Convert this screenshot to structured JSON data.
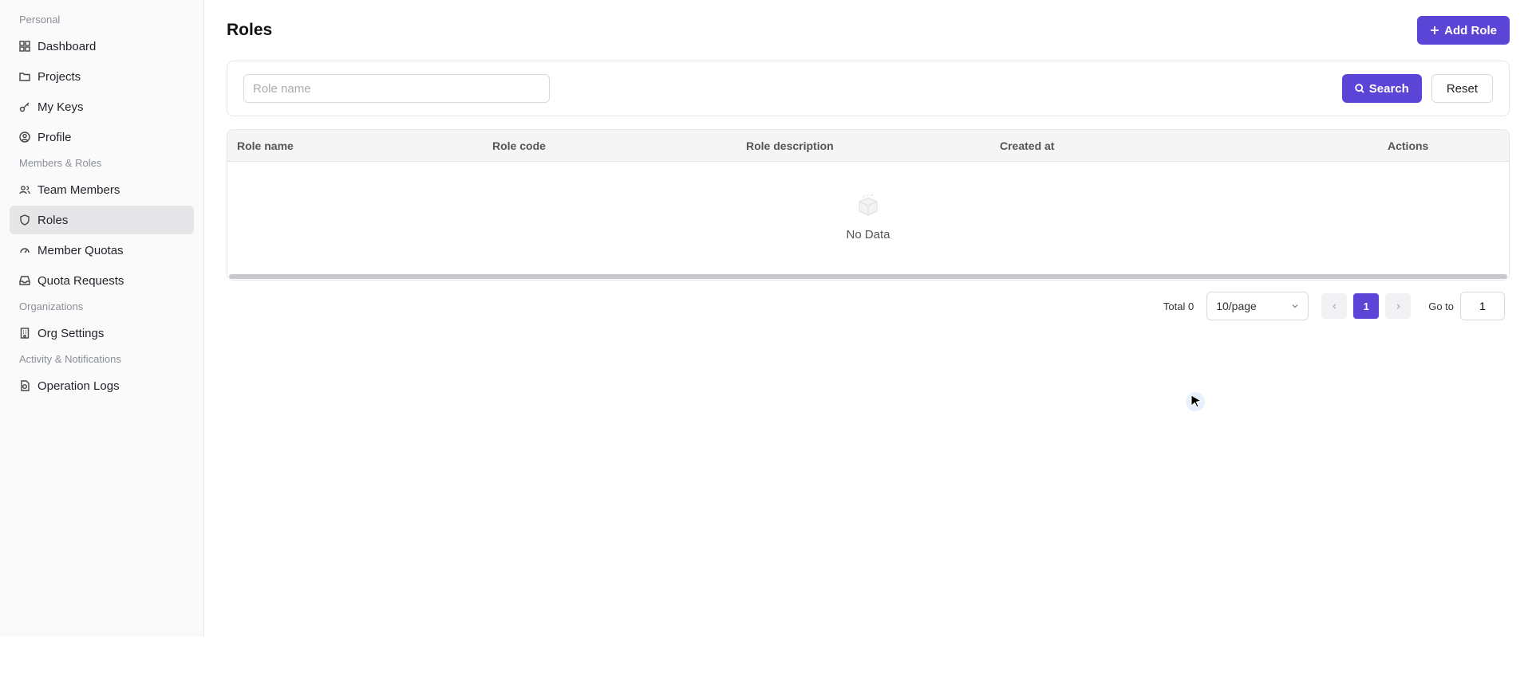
{
  "sidebar": {
    "sections": [
      {
        "title": "Personal",
        "items": [
          {
            "label": "Dashboard",
            "icon": "grid-icon"
          },
          {
            "label": "Projects",
            "icon": "folder-icon"
          },
          {
            "label": "My Keys",
            "icon": "key-icon"
          },
          {
            "label": "Profile",
            "icon": "user-circle-icon"
          }
        ]
      },
      {
        "title": "Members & Roles",
        "items": [
          {
            "label": "Team Members",
            "icon": "users-icon"
          },
          {
            "label": "Roles",
            "icon": "shield-icon",
            "active": true
          },
          {
            "label": "Member Quotas",
            "icon": "gauge-icon"
          },
          {
            "label": "Quota Requests",
            "icon": "inbox-icon"
          }
        ]
      },
      {
        "title": "Organizations",
        "items": [
          {
            "label": "Org Settings",
            "icon": "building-icon"
          }
        ]
      },
      {
        "title": "Activity & Notifications",
        "items": [
          {
            "label": "Operation Logs",
            "icon": "log-icon"
          }
        ]
      }
    ]
  },
  "header": {
    "title": "Roles",
    "add_button": "Add Role"
  },
  "filter": {
    "placeholder": "Role name",
    "value": "",
    "search_button": "Search",
    "reset_button": "Reset"
  },
  "table": {
    "columns": [
      "Role name",
      "Role code",
      "Role description",
      "Created at",
      "Actions"
    ],
    "rows": [],
    "empty_text": "No Data"
  },
  "pagination": {
    "total_label": "Total 0",
    "page_size": "10/page",
    "current_page": "1",
    "goto_label": "Go to",
    "goto_value": "1"
  },
  "colors": {
    "accent": "#5b45d6",
    "sidebar_bg": "#fafafa",
    "active_item_bg": "#e6e6e8"
  }
}
